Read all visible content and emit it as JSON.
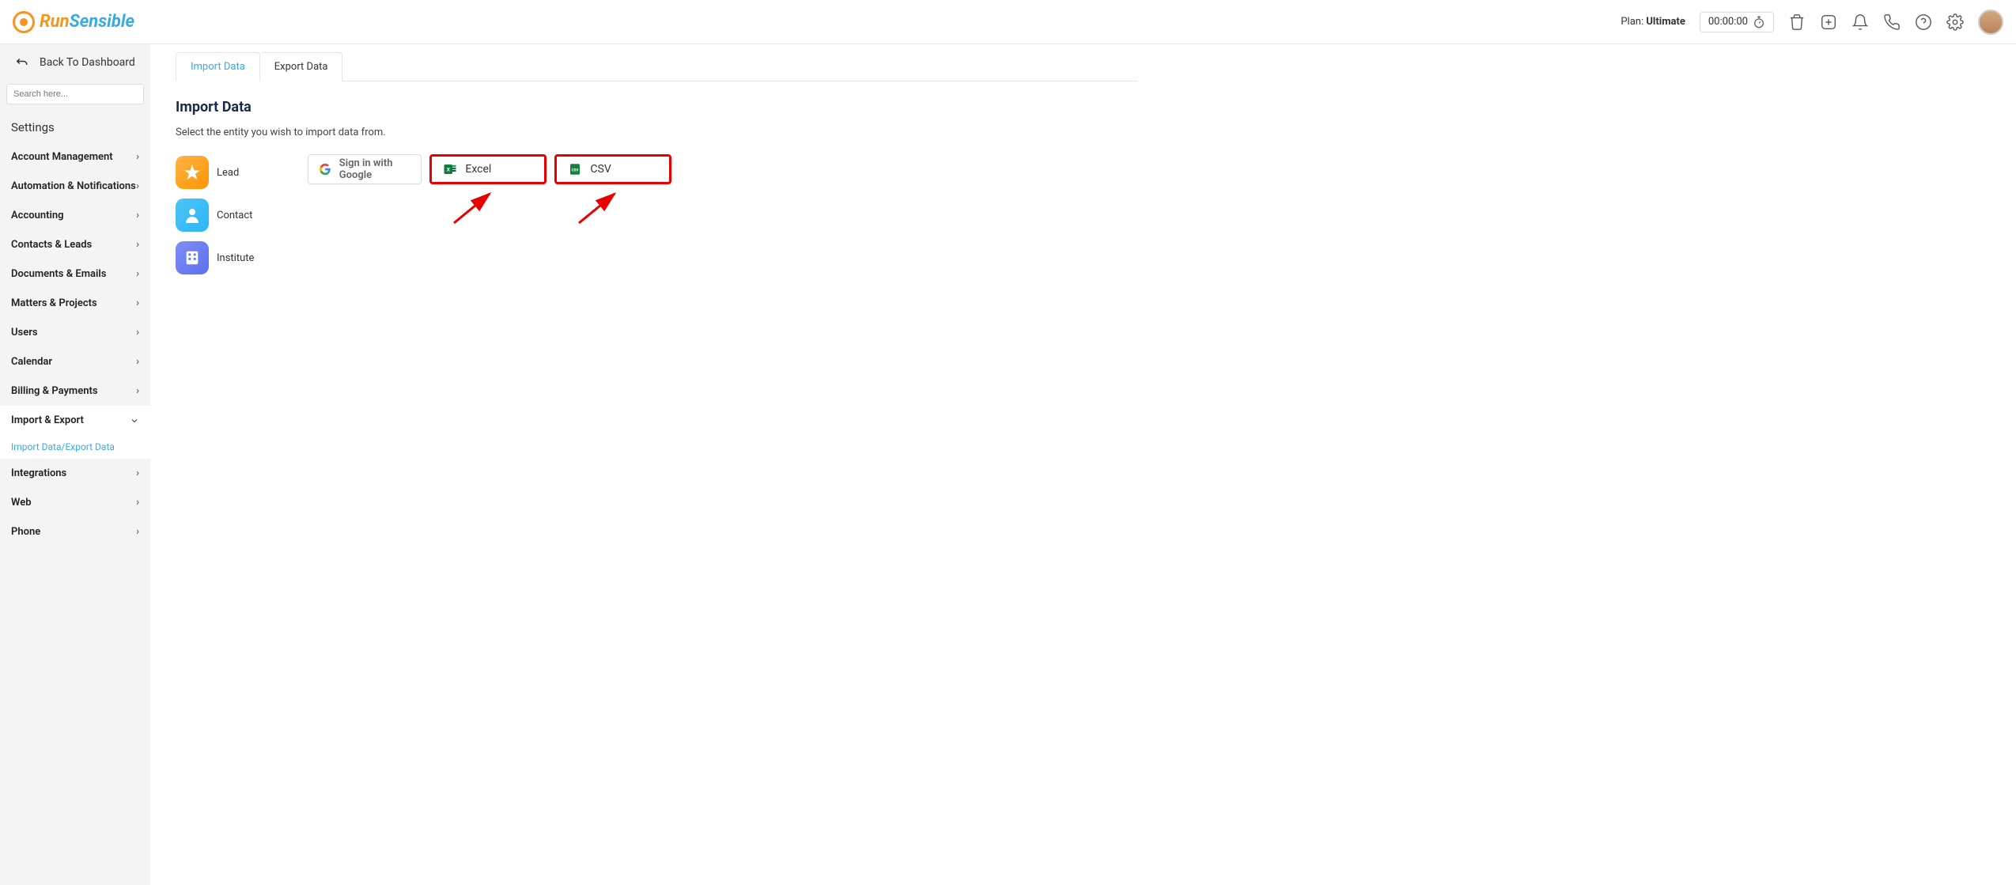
{
  "header": {
    "logo_run": "Run",
    "logo_sensible": "Sensible",
    "plan_label": "Plan:",
    "plan_value": "Ultimate",
    "timer": "00:00:00"
  },
  "sidebar": {
    "back_label": "Back To Dashboard",
    "search_placeholder": "Search here...",
    "settings_title": "Settings",
    "items": [
      {
        "label": "Account Management"
      },
      {
        "label": "Automation & Notifications"
      },
      {
        "label": "Accounting"
      },
      {
        "label": "Contacts & Leads"
      },
      {
        "label": "Documents & Emails"
      },
      {
        "label": "Matters & Projects"
      },
      {
        "label": "Users"
      },
      {
        "label": "Calendar"
      },
      {
        "label": "Billing & Payments"
      },
      {
        "label": "Import & Export"
      },
      {
        "label": "Integrations"
      },
      {
        "label": "Web"
      },
      {
        "label": "Phone"
      }
    ],
    "sub_item": "Import Data/Export Data"
  },
  "tabs": [
    {
      "label": "Import Data",
      "active": true
    },
    {
      "label": "Export Data",
      "active": false
    }
  ],
  "page": {
    "title": "Import Data",
    "subtitle": "Select the entity you wish to import data from."
  },
  "entities": [
    {
      "label": "Lead"
    },
    {
      "label": "Contact"
    },
    {
      "label": "Institute"
    }
  ],
  "buttons": {
    "google": "Sign in with Google",
    "excel": "Excel",
    "csv": "CSV"
  }
}
